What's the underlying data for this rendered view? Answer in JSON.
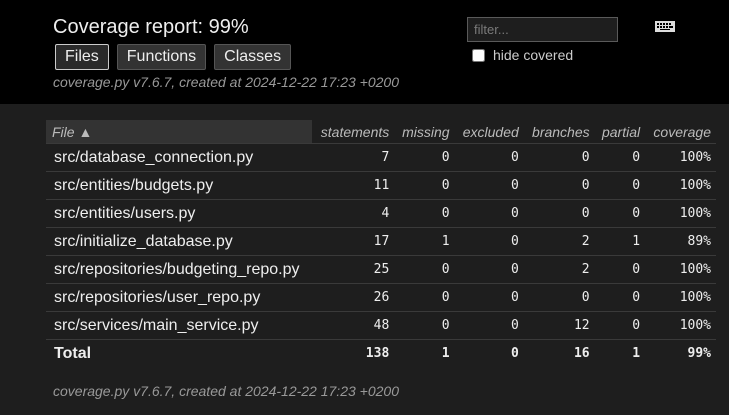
{
  "header": {
    "title": "Coverage report: 99%",
    "tabs": [
      "Files",
      "Functions",
      "Classes"
    ],
    "created": "coverage.py v7.6.7, created at 2024-12-22 17:23 +0200",
    "filter_placeholder": "filter...",
    "hide_covered_label": "hide covered",
    "keyboard_icon": "keyboard-icon"
  },
  "table": {
    "columns": [
      "File ▲",
      "statements",
      "missing",
      "excluded",
      "branches",
      "partial",
      "coverage"
    ],
    "rows": [
      {
        "file": "src/database_connection.py",
        "statements": "7",
        "missing": "0",
        "excluded": "0",
        "branches": "0",
        "partial": "0",
        "coverage": "100%"
      },
      {
        "file": "src/entities/budgets.py",
        "statements": "11",
        "missing": "0",
        "excluded": "0",
        "branches": "0",
        "partial": "0",
        "coverage": "100%"
      },
      {
        "file": "src/entities/users.py",
        "statements": "4",
        "missing": "0",
        "excluded": "0",
        "branches": "0",
        "partial": "0",
        "coverage": "100%"
      },
      {
        "file": "src/initialize_database.py",
        "statements": "17",
        "missing": "1",
        "excluded": "0",
        "branches": "2",
        "partial": "1",
        "coverage": "89%"
      },
      {
        "file": "src/repositories/budgeting_repo.py",
        "statements": "25",
        "missing": "0",
        "excluded": "0",
        "branches": "2",
        "partial": "0",
        "coverage": "100%"
      },
      {
        "file": "src/repositories/user_repo.py",
        "statements": "26",
        "missing": "0",
        "excluded": "0",
        "branches": "0",
        "partial": "0",
        "coverage": "100%"
      },
      {
        "file": "src/services/main_service.py",
        "statements": "48",
        "missing": "0",
        "excluded": "0",
        "branches": "12",
        "partial": "0",
        "coverage": "100%"
      }
    ],
    "total": {
      "label": "Total",
      "statements": "138",
      "missing": "1",
      "excluded": "0",
      "branches": "16",
      "partial": "1",
      "coverage": "99%"
    }
  },
  "footer": {
    "created": "coverage.py v7.6.7, created at 2024-12-22 17:23 +0200"
  }
}
